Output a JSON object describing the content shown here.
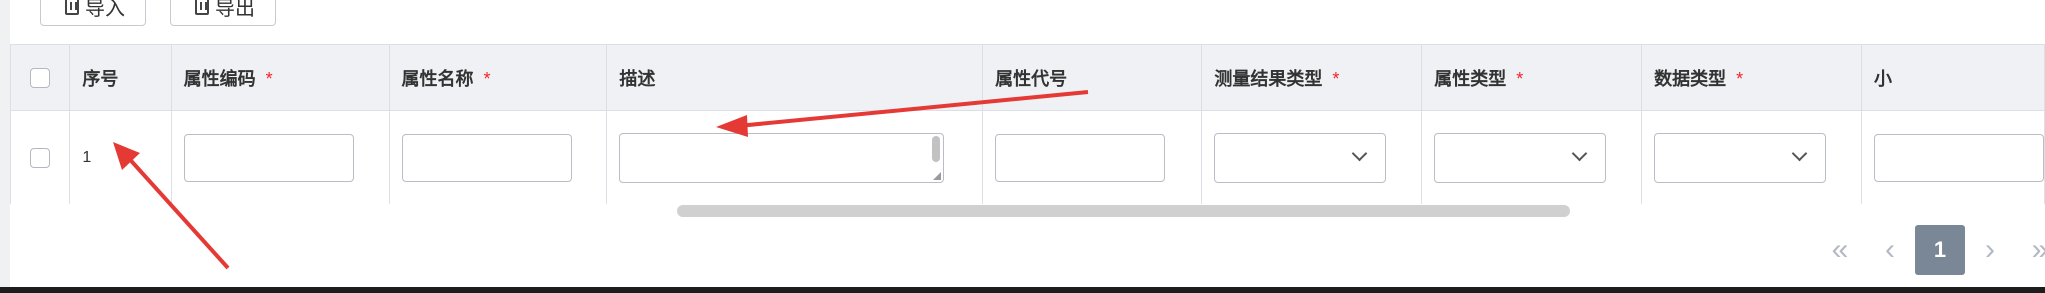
{
  "toolbar": {
    "import_label": "导入",
    "export_label": "导出"
  },
  "table": {
    "columns": [
      {
        "label": "序号",
        "required": ""
      },
      {
        "label": "属性编码",
        "required": "*"
      },
      {
        "label": "属性名称",
        "required": "*"
      },
      {
        "label": "描述",
        "required": ""
      },
      {
        "label": "属性代号",
        "required": ""
      },
      {
        "label": "测量结果类型",
        "required": "*"
      },
      {
        "label": "属性类型",
        "required": "*"
      },
      {
        "label": "数据类型",
        "required": "*"
      },
      {
        "label": "小",
        "required": ""
      }
    ],
    "rows": [
      {
        "index": "1"
      }
    ]
  },
  "pagination": {
    "first": "«",
    "prev": "‹",
    "current_page": "1",
    "next": "›",
    "last": "»"
  },
  "colors": {
    "header_bg": "#eff1f5",
    "required_star": "#f5222d",
    "annotation_arrow": "#e53935",
    "pager_active": "#7a8796"
  },
  "icons": [
    "file-icon",
    "checkbox",
    "chevron-down-icon",
    "double-chevron-left-icon",
    "chevron-left-icon",
    "chevron-right-icon",
    "double-chevron-right-icon"
  ]
}
